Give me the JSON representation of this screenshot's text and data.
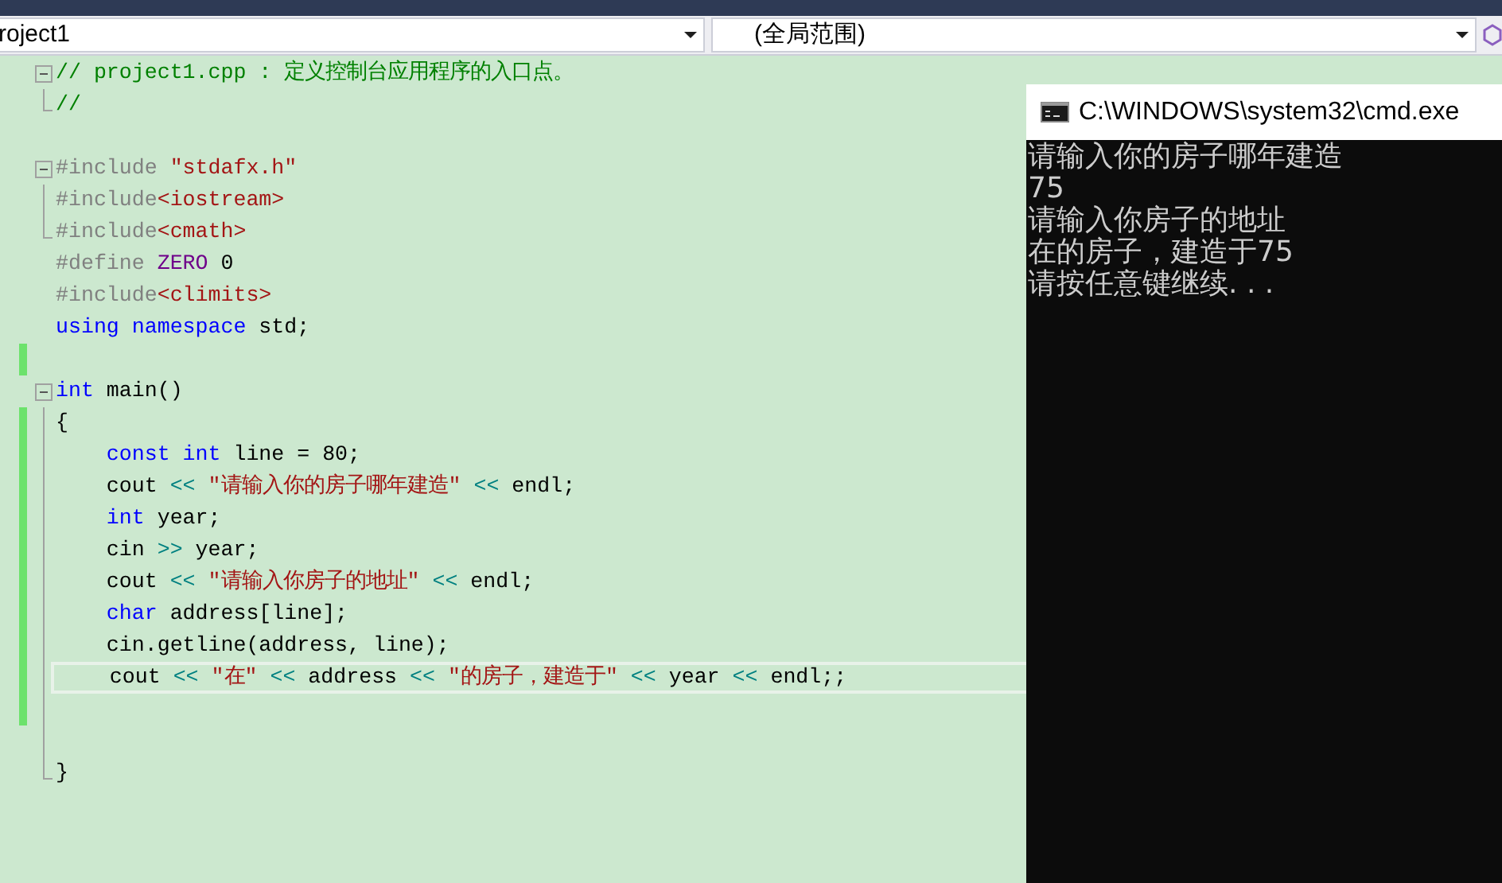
{
  "navigation_bar": {
    "project_combo": "roject1",
    "scope_combo": "(全局范围)"
  },
  "editor": {
    "lines": [
      {
        "kind": "fold-start",
        "changed": false,
        "current": false,
        "tokens": [
          {
            "kind": "comment",
            "text": "// project1.cpp : 定义控制台应用程序的入口点。"
          }
        ]
      },
      {
        "kind": "fold-end",
        "changed": false,
        "current": false,
        "tokens": [
          {
            "kind": "comment",
            "text": "//"
          }
        ]
      },
      {
        "kind": "plain",
        "changed": false,
        "current": false
      },
      {
        "kind": "fold-start",
        "changed": false,
        "current": false,
        "tokens": [
          {
            "kind": "preproc",
            "text": "#include "
          },
          {
            "kind": "string",
            "text": "\"stdafx.h\""
          }
        ]
      },
      {
        "kind": "fold-guide",
        "changed": false,
        "current": false,
        "tokens": [
          {
            "kind": "preproc",
            "text": "#include"
          },
          {
            "kind": "string",
            "text": "<iostream>"
          }
        ]
      },
      {
        "kind": "fold-end",
        "changed": false,
        "current": false,
        "tokens": [
          {
            "kind": "preproc",
            "text": "#include"
          },
          {
            "kind": "string",
            "text": "<cmath>"
          }
        ]
      },
      {
        "kind": "plain",
        "changed": false,
        "current": false,
        "tokens": [
          {
            "kind": "preproc",
            "text": "#define "
          },
          {
            "kind": "macro",
            "text": "ZERO"
          },
          {
            "kind": "plain",
            "text": " 0"
          }
        ]
      },
      {
        "kind": "plain",
        "changed": false,
        "current": false,
        "tokens": [
          {
            "kind": "preproc",
            "text": "#include"
          },
          {
            "kind": "string",
            "text": "<climits>"
          }
        ]
      },
      {
        "kind": "plain",
        "changed": false,
        "current": false,
        "tokens": [
          {
            "kind": "keyword",
            "text": "using namespace"
          },
          {
            "kind": "plain",
            "text": " std;"
          }
        ]
      },
      {
        "kind": "plain",
        "changed": true,
        "current": false
      },
      {
        "kind": "fold-start",
        "changed": false,
        "current": false,
        "tokens": [
          {
            "kind": "keyword",
            "text": "int"
          },
          {
            "kind": "plain",
            "text": " main()"
          }
        ]
      },
      {
        "kind": "fold-guide",
        "changed": true,
        "current": false,
        "tokens": [
          {
            "kind": "plain",
            "text": "{"
          }
        ]
      },
      {
        "kind": "fold-guide",
        "changed": true,
        "current": false,
        "tokens": [
          {
            "kind": "keyword",
            "text": "    const int"
          },
          {
            "kind": "plain",
            "text": " line = 80;"
          }
        ]
      },
      {
        "kind": "fold-guide",
        "changed": true,
        "current": false,
        "tokens": [
          {
            "kind": "plain",
            "text": "    cout "
          },
          {
            "kind": "operator",
            "text": "<<"
          },
          {
            "kind": "string",
            "text": " \"请输入你的房子哪年建造\" "
          },
          {
            "kind": "operator",
            "text": "<<"
          },
          {
            "kind": "plain",
            "text": " endl;"
          }
        ]
      },
      {
        "kind": "fold-guide",
        "changed": true,
        "current": false,
        "tokens": [
          {
            "kind": "keyword",
            "text": "    int"
          },
          {
            "kind": "plain",
            "text": " year;"
          }
        ]
      },
      {
        "kind": "fold-guide",
        "changed": true,
        "current": false,
        "tokens": [
          {
            "kind": "plain",
            "text": "    cin "
          },
          {
            "kind": "operator",
            "text": ">>"
          },
          {
            "kind": "plain",
            "text": " year;"
          }
        ]
      },
      {
        "kind": "fold-guide",
        "changed": true,
        "current": false,
        "tokens": [
          {
            "kind": "plain",
            "text": "    cout "
          },
          {
            "kind": "operator",
            "text": "<<"
          },
          {
            "kind": "string",
            "text": " \"请输入你房子的地址\" "
          },
          {
            "kind": "operator",
            "text": "<<"
          },
          {
            "kind": "plain",
            "text": " endl;"
          }
        ]
      },
      {
        "kind": "fold-guide",
        "changed": true,
        "current": false,
        "tokens": [
          {
            "kind": "keyword",
            "text": "    char"
          },
          {
            "kind": "plain",
            "text": " address[line];"
          }
        ]
      },
      {
        "kind": "fold-guide",
        "changed": true,
        "current": false,
        "tokens": [
          {
            "kind": "plain",
            "text": "    cin.getline(address, line);"
          }
        ]
      },
      {
        "kind": "fold-guide",
        "changed": true,
        "current": true,
        "tokens": [
          {
            "kind": "plain",
            "text": "    cout "
          },
          {
            "kind": "operator",
            "text": "<<"
          },
          {
            "kind": "string",
            "text": " \"在\" "
          },
          {
            "kind": "operator",
            "text": "<<"
          },
          {
            "kind": "plain",
            "text": " address "
          },
          {
            "kind": "operator",
            "text": "<<"
          },
          {
            "kind": "string",
            "text": " \"的房子，建造于\" "
          },
          {
            "kind": "operator",
            "text": "<<"
          },
          {
            "kind": "plain",
            "text": " year "
          },
          {
            "kind": "operator",
            "text": "<<"
          },
          {
            "kind": "plain",
            "text": " endl;;"
          }
        ]
      },
      {
        "kind": "fold-guide",
        "changed": true,
        "current": false
      },
      {
        "kind": "fold-guide",
        "changed": false,
        "current": false
      },
      {
        "kind": "fold-end",
        "changed": false,
        "current": false,
        "tokens": [
          {
            "kind": "plain",
            "text": "}"
          }
        ]
      }
    ]
  },
  "console_window": {
    "title": "C:\\WINDOWS\\system32\\cmd.exe",
    "output": [
      "请输入你的房子哪年建造",
      "75",
      "请输入你房子的地址",
      "在的房子，建造于75",
      "请按任意键继续. . ."
    ]
  }
}
